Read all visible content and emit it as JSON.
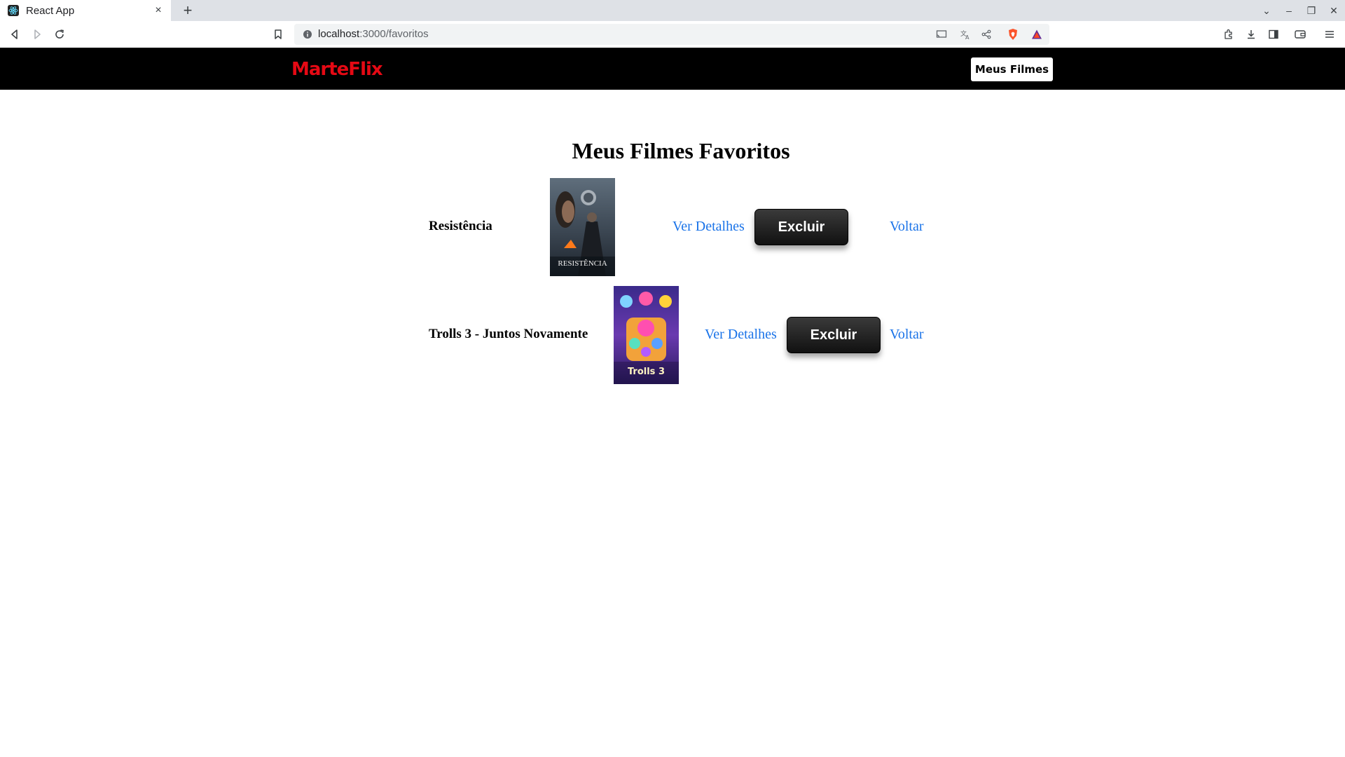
{
  "browser": {
    "tab_title": "React App",
    "tab_close": "×",
    "new_tab": "+",
    "url_host": "localhost",
    "url_path": ":3000/favoritos",
    "window_controls": [
      "⌄",
      "–",
      "❐",
      "✕"
    ]
  },
  "app": {
    "logo": "MarteFlix",
    "nav_button": "Meus Filmes",
    "page_title": "Meus Filmes Favoritos",
    "movies": [
      {
        "title": "Resistência",
        "poster_caption": "RESISTÊNCIA",
        "details_label": "Ver Detalhes",
        "delete_label": "Excluir",
        "back_label": "Voltar"
      },
      {
        "title": "Trolls 3 - Juntos Novamente",
        "poster_caption": "Trolls 3",
        "details_label": "Ver Detalhes",
        "delete_label": "Excluir",
        "back_label": "Voltar"
      }
    ]
  },
  "colors": {
    "logo_red": "#e50914",
    "link_blue": "#1a73e8",
    "header_black": "#000000"
  }
}
